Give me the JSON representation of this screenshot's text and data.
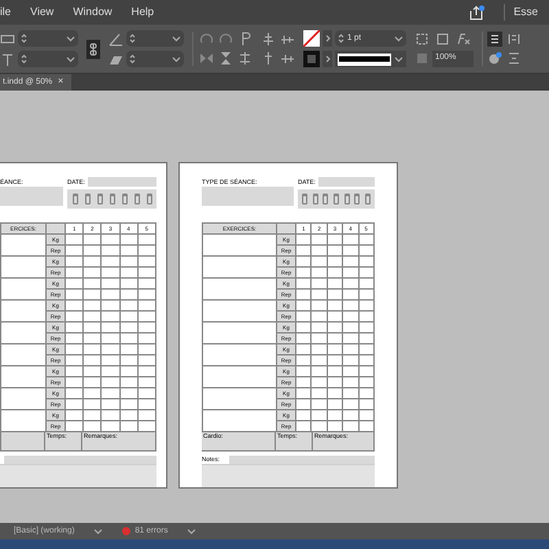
{
  "menu": [
    {
      "label": "ile"
    },
    {
      "label": "View"
    },
    {
      "label": "Window"
    },
    {
      "label": "Help"
    }
  ],
  "workspace": "Esse",
  "control_panel": {
    "stroke_weight": "1 pt",
    "opacity": "100%"
  },
  "doc_tab": {
    "title": "t.indd @ 50%",
    "close": "×"
  },
  "pages": [
    {
      "kind": "cut",
      "session_label": "ÉANCE:",
      "date_label": "DATE:",
      "exercise_header": "ERCICES:",
      "set_numbers": [
        "1",
        "2",
        "3",
        "4",
        "5"
      ],
      "rows": [
        "Kg",
        "Rep",
        "Kg",
        "Rep",
        "Kg",
        "Rep",
        "Kg",
        "Rep",
        "Kg",
        "Rep",
        "Kg",
        "Rep",
        "Kg",
        "Rep",
        "Kg",
        "Rep",
        "Kg",
        "Rep"
      ],
      "footer": [
        "Temps:",
        "Remarques:"
      ]
    },
    {
      "kind": "full",
      "session_label": "TYPE DE SÉANCE:",
      "date_label": "DATE:",
      "exercise_header": "EXERCICES:",
      "set_numbers": [
        "1",
        "2",
        "3",
        "4",
        "5"
      ],
      "rows": [
        "Kg",
        "Rep",
        "Kg",
        "Rep",
        "Kg",
        "Rep",
        "Kg",
        "Rep",
        "Kg",
        "Rep",
        "Kg",
        "Rep",
        "Kg",
        "Rep",
        "Kg",
        "Rep",
        "Kg",
        "Rep"
      ],
      "footer": [
        "Cardio:",
        "Temps:",
        "Remarques:"
      ],
      "notes_label": "Notes:"
    }
  ],
  "status": {
    "preflight": "[Basic] (working)",
    "errors": "81 errors"
  }
}
